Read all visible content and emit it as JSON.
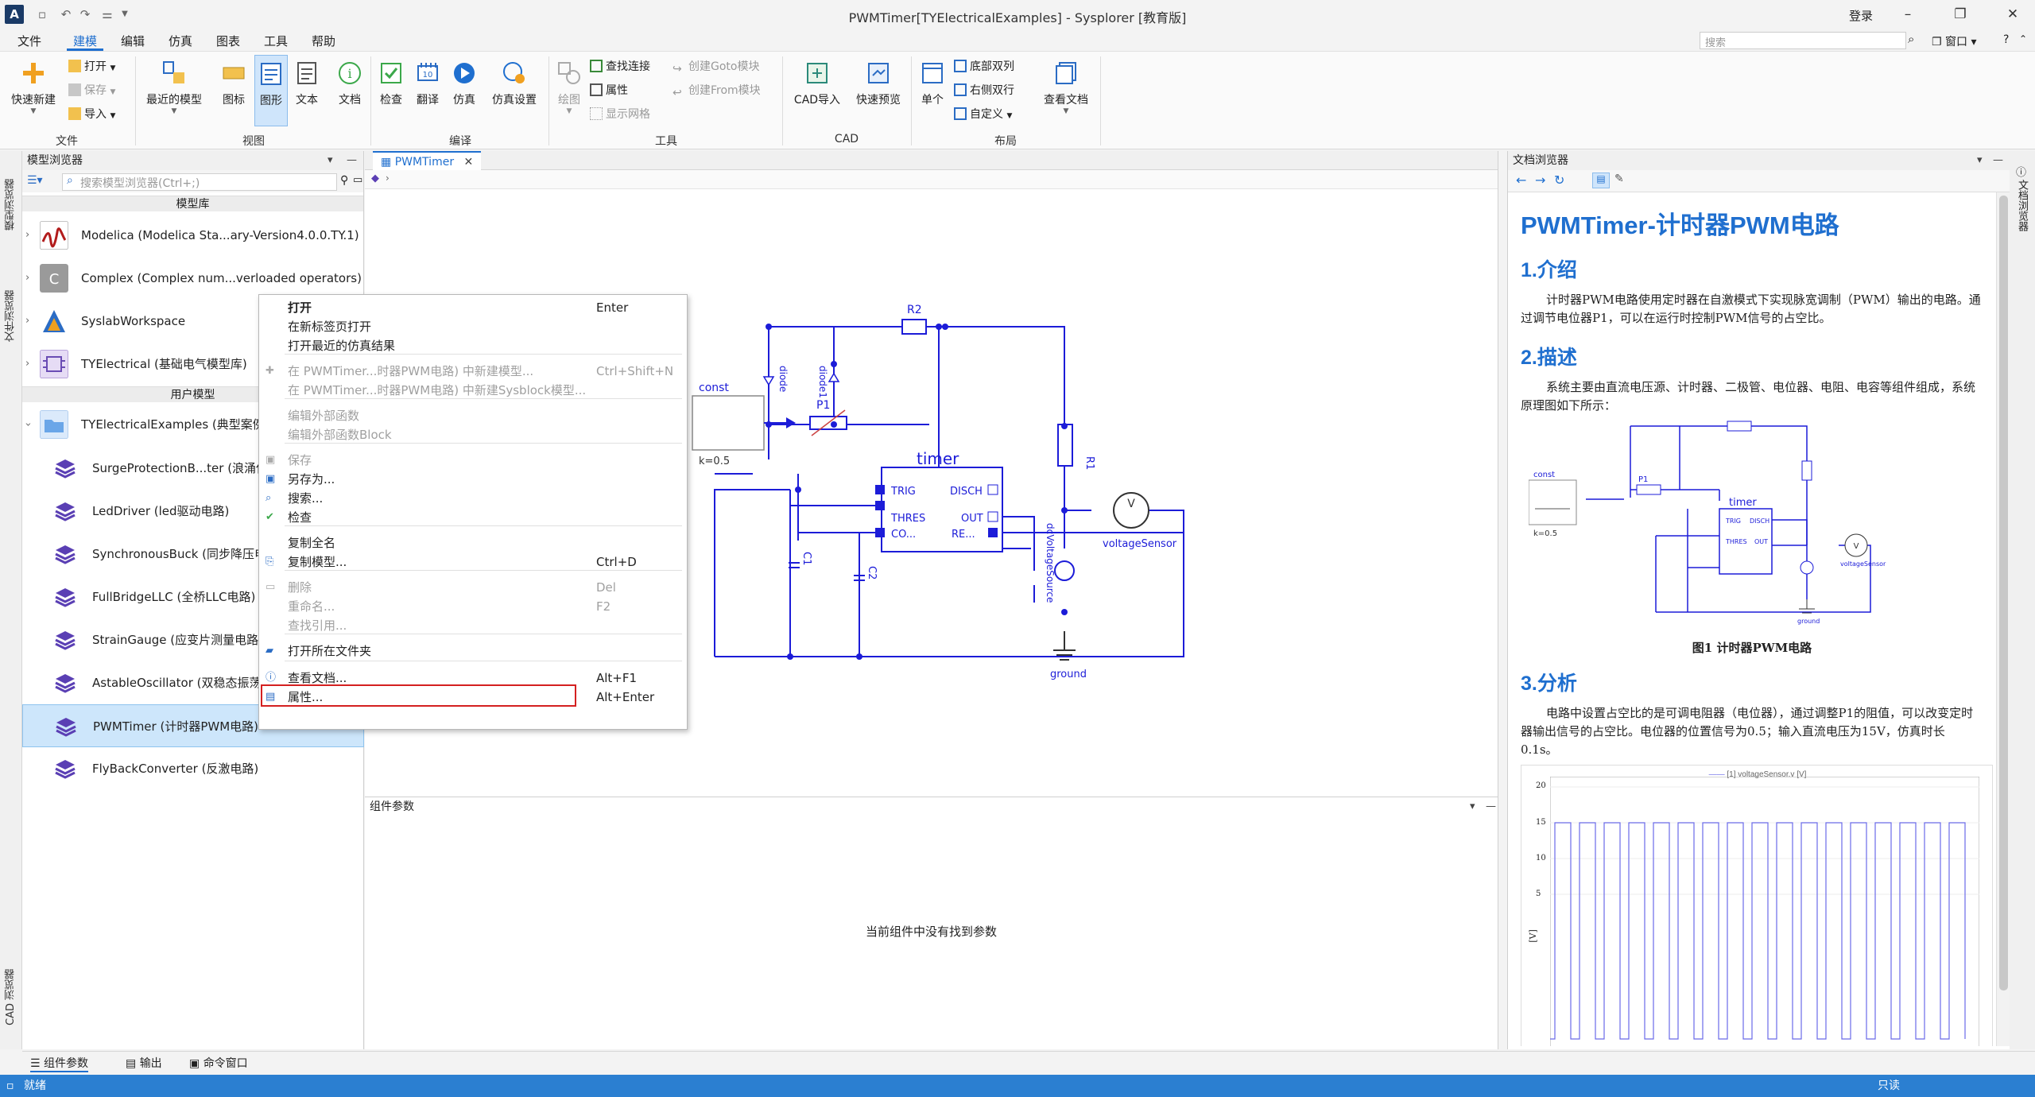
{
  "window": {
    "title": "PWMTimer[TYElectricalExamples] - Sysplorer [教育版]",
    "login": "登录"
  },
  "menubar": {
    "items": [
      "文件",
      "建模",
      "编辑",
      "仿真",
      "图表",
      "工具",
      "帮助"
    ],
    "active": "建模",
    "search_placeholder": "搜索",
    "window_menu": "窗口"
  },
  "ribbon": {
    "file": {
      "new": "快速新建",
      "open": "打开",
      "save": "保存",
      "import": "导入",
      "group": "文件"
    },
    "view": {
      "recent": "最近的模型",
      "icon": "图标",
      "diagram": "图形",
      "text": "文本",
      "doc": "文档",
      "group": "视图"
    },
    "compile": {
      "check": "检查",
      "translate": "翻译",
      "simulate": "仿真",
      "sim_settings": "仿真设置",
      "group": "编译"
    },
    "tools": {
      "draw": "绘图",
      "find_connect": "查找连接",
      "attrs": "属性",
      "show_grid": "显示网格",
      "goto": "创建Goto模块",
      "from": "创建From模块",
      "group": "工具"
    },
    "cad": {
      "import": "CAD导入",
      "preview": "快速预览",
      "group": "CAD"
    },
    "layout": {
      "single": "单个",
      "bottom_two": "底部双列",
      "right_two": "右侧双行",
      "custom": "自定义",
      "view_doc": "查看文档",
      "group": "布局"
    }
  },
  "left_strip": {
    "tabs": [
      "模型浏览器",
      "文件浏览器",
      "CAD 浏览器"
    ]
  },
  "model_browser": {
    "title": "模型浏览器",
    "search_placeholder": "搜索模型浏览器(Ctrl+;)",
    "library_section": "模型库",
    "user_section": "用户模型",
    "libraries": [
      {
        "label": "Modelica (Modelica Sta...ary-Version4.0.0.TY.1)",
        "icon": "modelica-icon"
      },
      {
        "label": "Complex (Complex num...verloaded operators)",
        "icon": "complex-icon"
      },
      {
        "label": "SyslabWorkspace",
        "icon": "syslab-icon"
      },
      {
        "label": "TYElectrical (基础电气模型库)",
        "icon": "tyelectrical-icon"
      }
    ],
    "user_root": "TYElectricalExamples (典型案例)",
    "user_models": [
      "SurgeProtectionB...ter (浪涌保",
      "LedDriver (led驱动电路)",
      "SynchronousBuck (同步降压电",
      "FullBridgeLLC (全桥LLC电路)",
      "StrainGauge (应变片测量电路)",
      "AstableOscillator (双稳态振荡",
      "PWMTimer (计时器PWM电路)",
      "FlyBackConverter (反激电路)"
    ],
    "selected_index": 6
  },
  "context_menu": {
    "items": [
      {
        "label": "打开",
        "shortcut": "Enter",
        "disabled": false,
        "bold": true
      },
      {
        "label": "在新标签页打开",
        "shortcut": "",
        "disabled": false
      },
      {
        "label": "打开最近的仿真结果",
        "shortcut": "",
        "disabled": false
      },
      {
        "label": "在 PWMTimer...时器PWM电路) 中新建模型...",
        "shortcut": "Ctrl+Shift+N",
        "disabled": true
      },
      {
        "label": "在 PWMTimer...时器PWM电路) 中新建Sysblock模型...",
        "shortcut": "",
        "disabled": true
      },
      {
        "label": "编辑外部函数",
        "shortcut": "",
        "disabled": true
      },
      {
        "label": "编辑外部函数Block",
        "shortcut": "",
        "disabled": true
      },
      {
        "label": "保存",
        "shortcut": "",
        "disabled": true
      },
      {
        "label": "另存为...",
        "shortcut": "",
        "disabled": false
      },
      {
        "label": "搜索...",
        "shortcut": "",
        "disabled": false
      },
      {
        "label": "检查",
        "shortcut": "",
        "disabled": false
      },
      {
        "label": "复制全名",
        "shortcut": "",
        "disabled": false
      },
      {
        "label": "复制模型...",
        "shortcut": "Ctrl+D",
        "disabled": false
      },
      {
        "label": "删除",
        "shortcut": "Del",
        "disabled": true
      },
      {
        "label": "重命名...",
        "shortcut": "F2",
        "disabled": true
      },
      {
        "label": "查找引用...",
        "shortcut": "",
        "disabled": true
      },
      {
        "label": "打开所在文件夹",
        "shortcut": "",
        "disabled": false
      },
      {
        "label": "查看文档...",
        "shortcut": "Alt+F1",
        "disabled": false
      },
      {
        "label": "属性...",
        "shortcut": "Alt+Enter",
        "disabled": false
      }
    ]
  },
  "editor": {
    "tab": "PWMTimer",
    "diagram": {
      "title": "timer",
      "labels": {
        "r2": "R2",
        "r1": "R1",
        "p1": "P1",
        "diode": "diode",
        "diode1": "diode1",
        "const": "const",
        "k": "k=0.5",
        "c1": "C1",
        "c2": "C2",
        "trig": "TRIG",
        "thres": "THRES",
        "co": "CO...",
        "re": "RE...",
        "disch": "DISCH",
        "out": "OUT",
        "dc": "dcVoltageSource",
        "vs": "voltageSensor",
        "ground": "ground"
      }
    }
  },
  "params": {
    "title": "组件参数",
    "empty": "当前组件中没有找到参数"
  },
  "doc": {
    "panel_title": "文档浏览器",
    "h1": "PWMTimer-计时器PWM电路",
    "s1": "1.介绍",
    "p1": "计时器PWM电路使用定时器在自激模式下实现脉宽调制（PWM）输出的电路。通过调节电位器P1，可以在运行时控制PWM信号的占空比。",
    "s2": "2.描述",
    "p2": "系统主要由直流电压源、计时器、二极管、电位器、电阻、电容等组件组成，系统原理图如下所示：",
    "fig_caption": "图1 计时器PWM电路",
    "s3": "3.分析",
    "p3": "电路中设置占空比的是可调电阻器（电位器），通过调整P1的阻值，可以改变定时器输出信号的占空比。电位器的位置信号为0.5；输入直流电压为15V，仿真时长0.1s。",
    "plot_legend": "[1] voltageSensor.v [V]",
    "plot_yticks": [
      "20",
      "15",
      "10",
      "5"
    ],
    "plot_ylabel": "[V]"
  },
  "right_strip": {
    "tab": "文档浏览器"
  },
  "bottom_tabs": [
    "组件参数",
    "输出",
    "命令窗口"
  ],
  "status": {
    "left": "就绪",
    "right": "只读"
  },
  "colors": {
    "accent": "#1f6fcf",
    "status_bar": "#2b7fd1",
    "diagram_blue": "#1c1cd8",
    "highlight_red": "#d42020"
  }
}
